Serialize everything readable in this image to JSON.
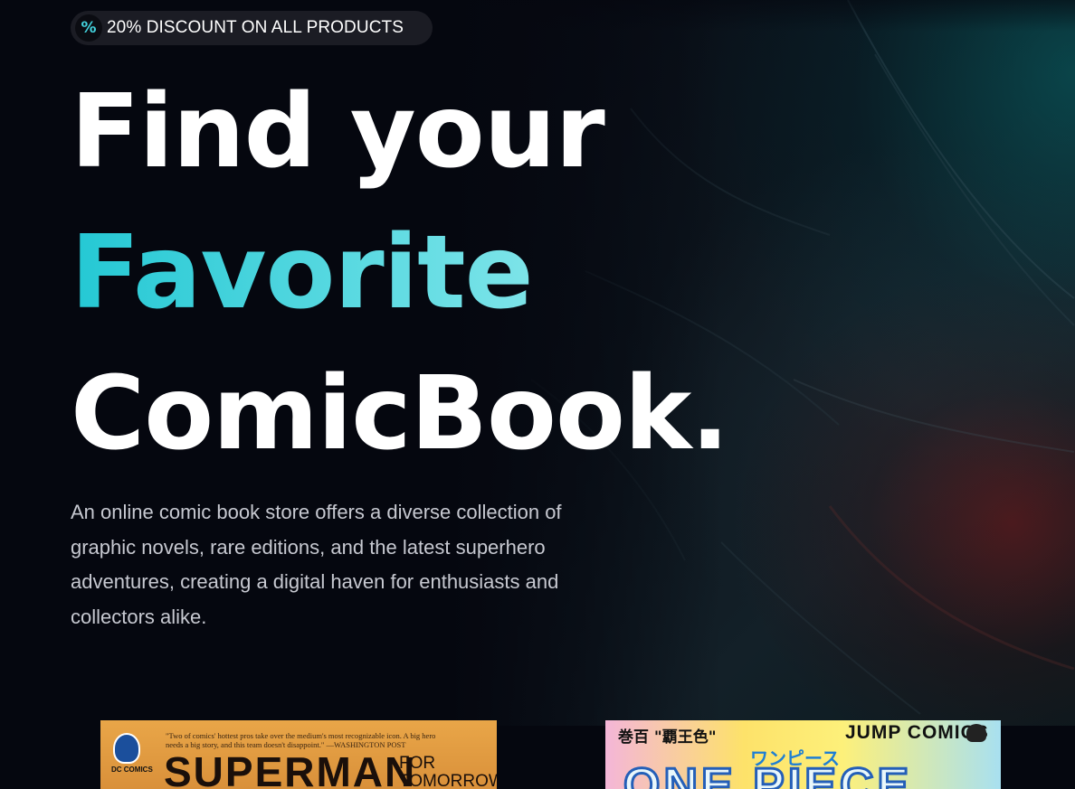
{
  "promo": {
    "icon": "percent-icon",
    "icon_glyph": "%",
    "text": "20% DISCOUNT ON ALL PRODUCTS"
  },
  "hero": {
    "line1": "Find your",
    "line2": "Favorite",
    "line3": "ComicBook.",
    "description": "An online comic book store offers a diverse collection of graphic novels, rare editions, and the latest superhero adventures, creating a digital haven for enthusiasts and collectors alike.",
    "accent_color": "#43d3de",
    "background_color": "#05070f"
  },
  "covers": [
    {
      "publisher": "DC COMICS",
      "quote": "\"Two of comics' hottest pros take over the medium's most recognizable icon. A big hero needs a big story, and this team doesn't disappoint.\" —WASHINGTON POST",
      "title": "SUPERMAN",
      "subtitle": "FOR TOMORROW"
    },
    {
      "volume": "巻百",
      "tagline": "\"覇王色\"",
      "imprint": "JUMP COMICS",
      "katakana": "ワンピース",
      "title": "ONE PIECE"
    }
  ]
}
